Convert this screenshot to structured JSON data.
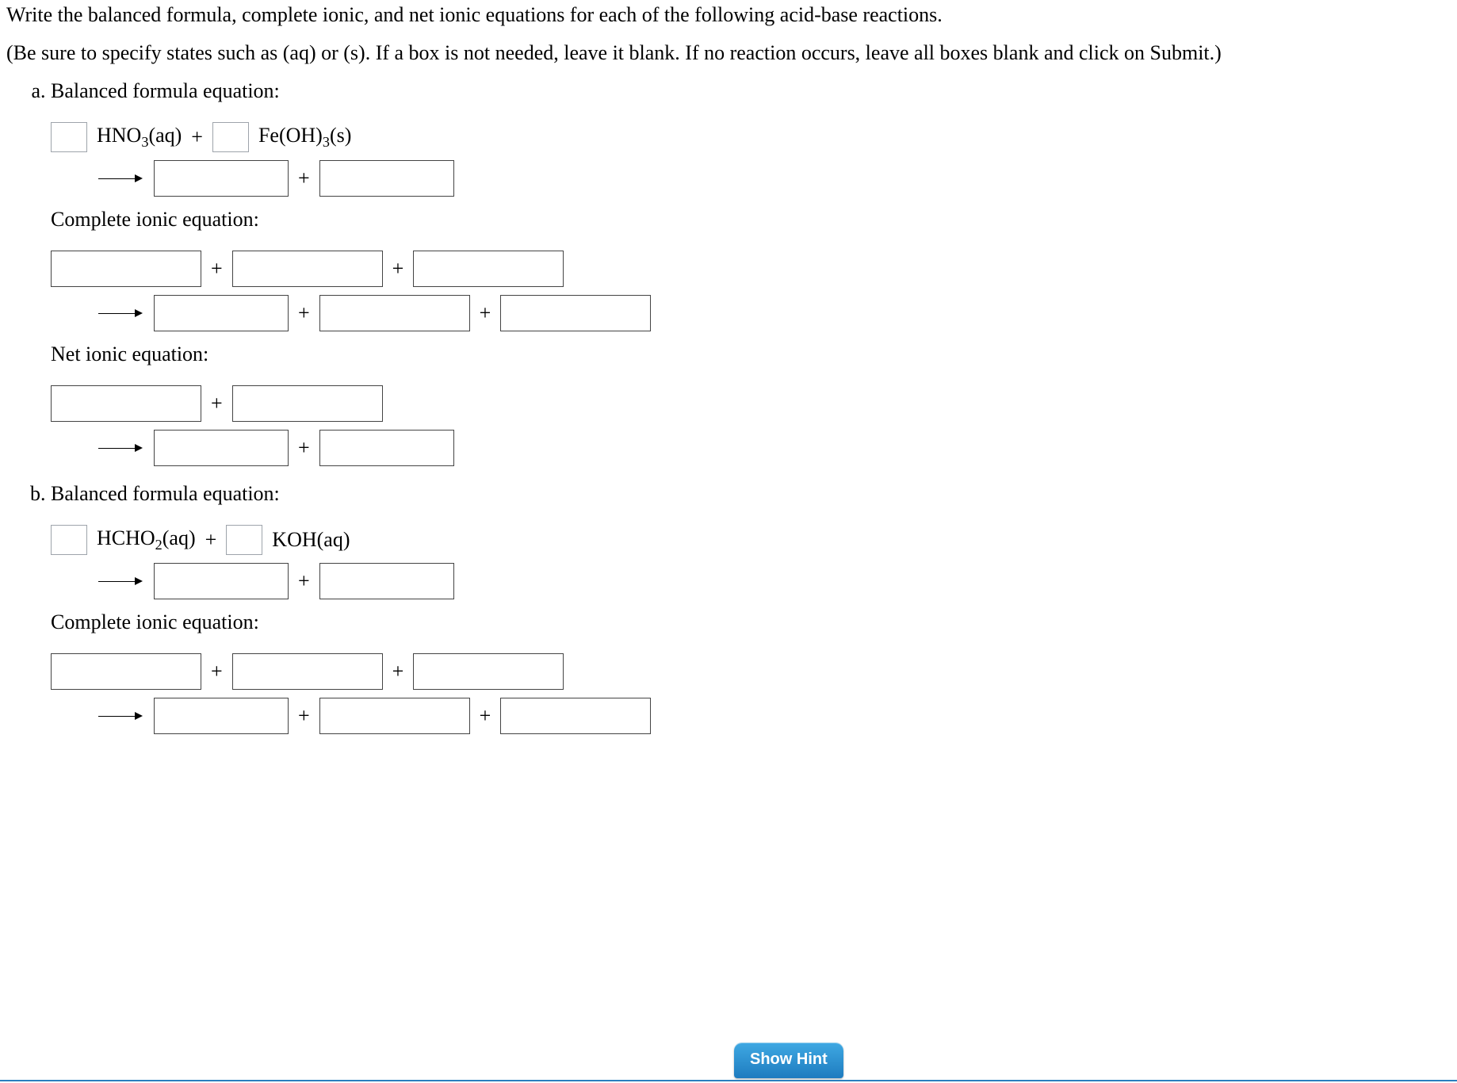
{
  "intro_line1": "Write the balanced formula, complete ionic, and net ionic equations for each of the following acid-base reactions.",
  "intro_line2": "(Be sure to specify states such as (aq) or (s). If a box is not needed, leave it blank. If no reaction occurs, leave all boxes blank and click on Submit.)",
  "labels": {
    "balanced": "Balanced formula equation:",
    "complete_ionic": "Complete ionic equation:",
    "net_ionic": "Net ionic equation:",
    "plus": "+"
  },
  "hint_button": "Show Hint",
  "partA": {
    "reactant1_html": "HNO<sub class=\"sub\">3</sub>(aq)",
    "reactant2_html": "Fe(OH)<sub class=\"sub\">3</sub>(s)"
  },
  "partB": {
    "reactant1_html": "HCHO<sub class=\"sub\">2</sub>(aq)",
    "reactant2_html": "KOH(aq)"
  }
}
